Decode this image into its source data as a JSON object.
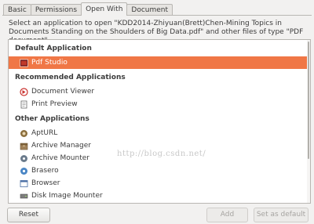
{
  "tabs": [
    {
      "label": "Basic",
      "active": false
    },
    {
      "label": "Permissions",
      "active": false
    },
    {
      "label": "Open With",
      "active": true
    },
    {
      "label": "Document",
      "active": false
    }
  ],
  "intro_text": "Select an application to open \"KDD2014-Zhiyuan(Brett)Chen-Mining Topics in Documents Standing on the Shoulders of Big Data.pdf\" and other files of type \"PDF document\"",
  "sections": {
    "default": "Default Application",
    "recommended": "Recommended Applications",
    "other": "Other Applications"
  },
  "default_app": {
    "label": "Pdf Studio",
    "icon": "pdf-studio-icon",
    "selected": true
  },
  "recommended_apps": [
    {
      "label": "Document Viewer",
      "icon": "document-viewer-icon"
    },
    {
      "label": "Print Preview",
      "icon": "print-preview-icon"
    }
  ],
  "other_apps": [
    {
      "label": "AptURL",
      "icon": "apturl-icon"
    },
    {
      "label": "Archive Manager",
      "icon": "archive-manager-icon"
    },
    {
      "label": "Archive Mounter",
      "icon": "archive-mounter-icon"
    },
    {
      "label": "Brasero",
      "icon": "brasero-icon"
    },
    {
      "label": "Browser",
      "icon": "browser-icon"
    },
    {
      "label": "Disk Image Mounter",
      "icon": "disk-image-mounter-icon"
    }
  ],
  "watermark": "http://blog.csdn.net/",
  "buttons": {
    "reset": "Reset",
    "add": "Add",
    "set_default": "Set as default"
  },
  "colors": {
    "selection": "#f07746",
    "window_bg": "#f2f1f0"
  }
}
